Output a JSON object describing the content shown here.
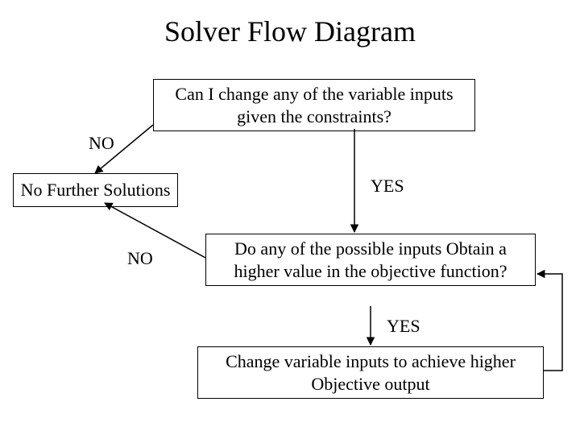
{
  "title": "Solver Flow Diagram",
  "boxes": {
    "q1": "Can I change any of the variable inputs given the constraints?",
    "no_further": "No Further Solutions",
    "q2": "Do any of the possible inputs Obtain a higher value in the objective function?",
    "change": "Change variable inputs to achieve higher Objective output"
  },
  "labels": {
    "no1": "NO",
    "yes1": "YES",
    "no2": "NO",
    "yes2": "YES"
  }
}
